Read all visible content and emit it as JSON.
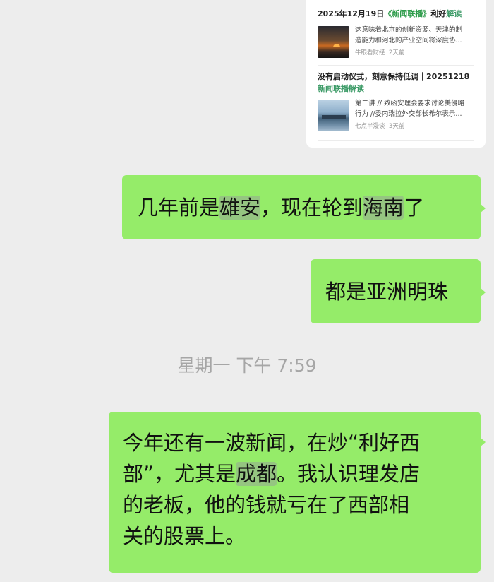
{
  "news_card": {
    "items": [
      {
        "title_prefix": "2025年12月19日",
        "title_highlight": "《新闻联播》",
        "title_mid": "利好",
        "title_suffix": "解读",
        "thumbnail_icon": "sunset-thumbnail",
        "snippet_line1": "这意味着北京的创新资源、天津的制",
        "snippet_line2": "造能力和河北的产业空间将深度协...",
        "source": "牛眼看财经",
        "time": "2天前"
      },
      {
        "title_line1": "没有启动仪式，刻意保持低调｜20251218",
        "title_line2": "新闻联播解读",
        "thumbnail_icon": "ship-thumbnail",
        "snippet_line1": "第二讲 // 致函安理会要求讨论美侵略",
        "snippet_line2": "行为 //委内瑞拉外交部长希尔表示...",
        "source": "七点半漫谈",
        "time": "3天前"
      }
    ]
  },
  "messages": [
    {
      "pre": "几年前是",
      "blur1": "雄安",
      "mid": "，现在轮到",
      "blur2": "海南",
      "post": "了"
    },
    {
      "text": "都是亚洲明珠"
    },
    {
      "line1": "今年还有一波新闻，在炒“利好西",
      "line2_pre": "部”，尤其是",
      "line2_blur": "成都",
      "line2_post": "。我认识理发店",
      "line3": "的老板，他的钱就亏在了西部相",
      "line4": "关的股票上。"
    }
  ],
  "timestamp": "星期一 下午 7:59"
}
